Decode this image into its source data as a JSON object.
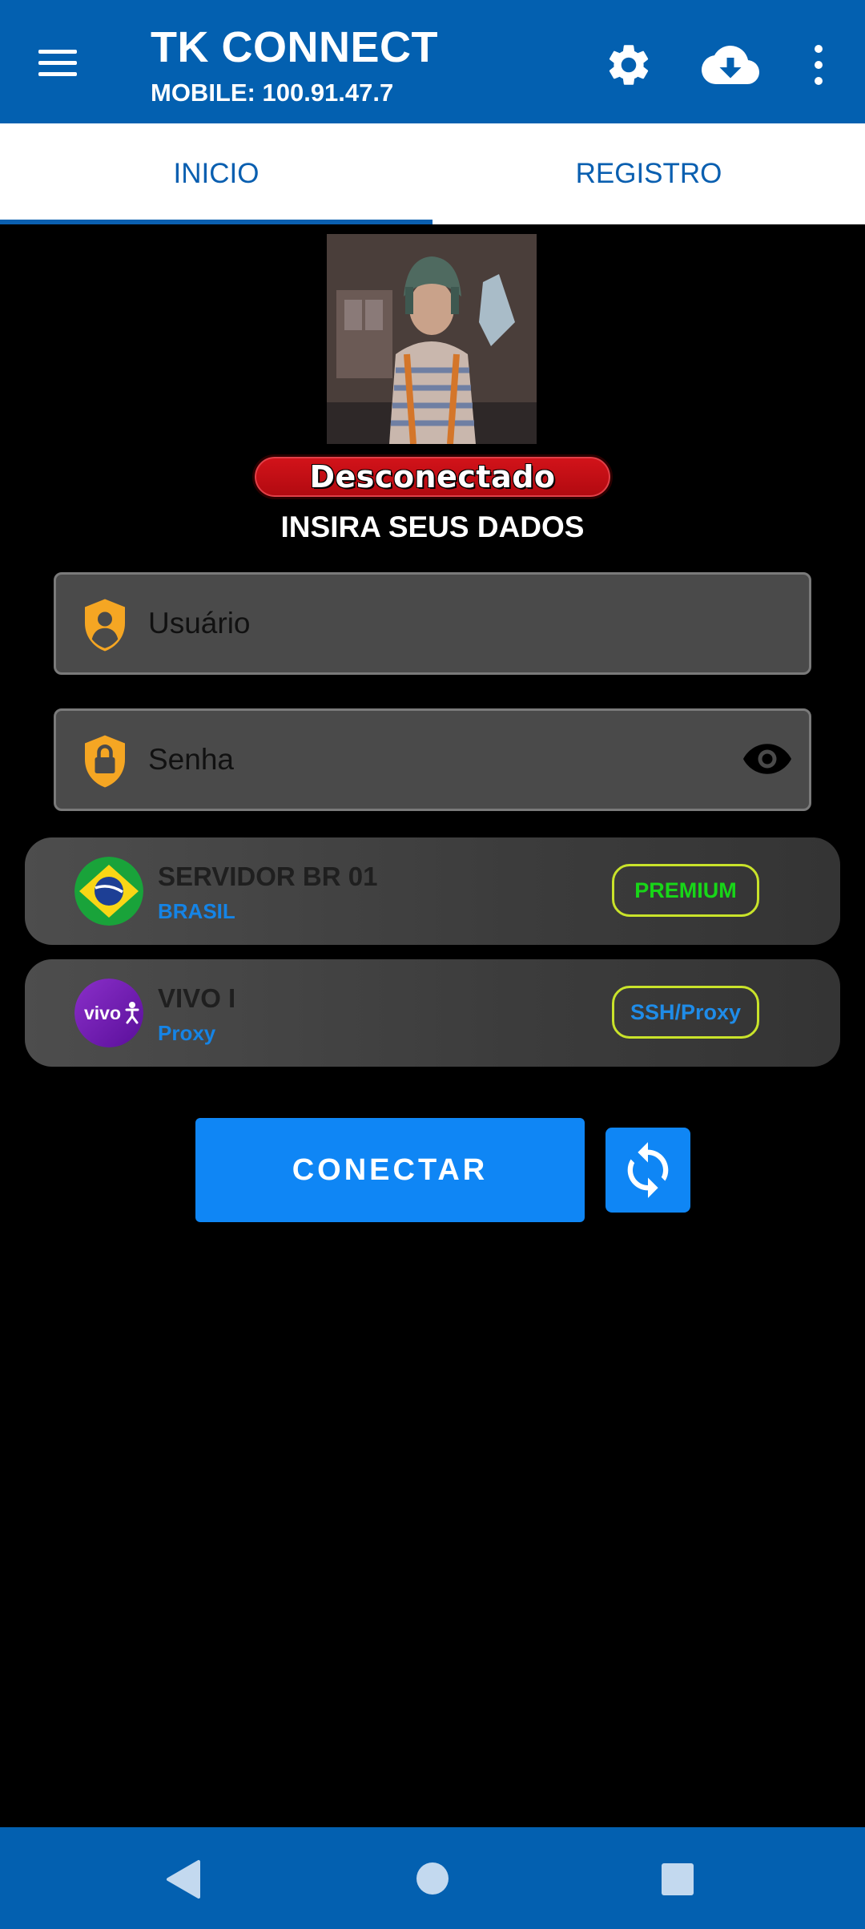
{
  "app": {
    "title": "TK CONNECT",
    "subtitle": "MOBILE: 100.91.47.7",
    "bar_color": "#0360b0",
    "icons": [
      "menu-icon",
      "gear-icon",
      "cloud-download-icon",
      "more-vert-icon"
    ]
  },
  "tabs": [
    {
      "label": "INICIO",
      "selected": true
    },
    {
      "label": "REGISTRO",
      "selected": false
    }
  ],
  "status": {
    "label": "Desconectado",
    "color": "#d3131a"
  },
  "instruction": "INSIRA SEUS DADOS",
  "fields": {
    "username": {
      "placeholder": "Usuário",
      "value": "",
      "icon": "user-shield-icon"
    },
    "password": {
      "placeholder": "Senha",
      "value": "",
      "icon": "lock-shield-icon",
      "toggle_icon": "eye-icon"
    }
  },
  "servers": [
    {
      "name": "SERVIDOR BR 01",
      "subtitle": "BRASIL",
      "badge": "PREMIUM",
      "icon": "brazil-flag-icon"
    },
    {
      "name": "VIVO I",
      "subtitle": "Proxy",
      "badge": "SSH/Proxy",
      "icon": "vivo-logo-icon"
    }
  ],
  "actions": {
    "connect_label": "CONECTAR",
    "refresh_icon": "refresh-icon",
    "accent": "#0f86f5"
  },
  "navbar": {
    "icons": [
      "back-icon",
      "home-icon",
      "recents-icon"
    ]
  }
}
